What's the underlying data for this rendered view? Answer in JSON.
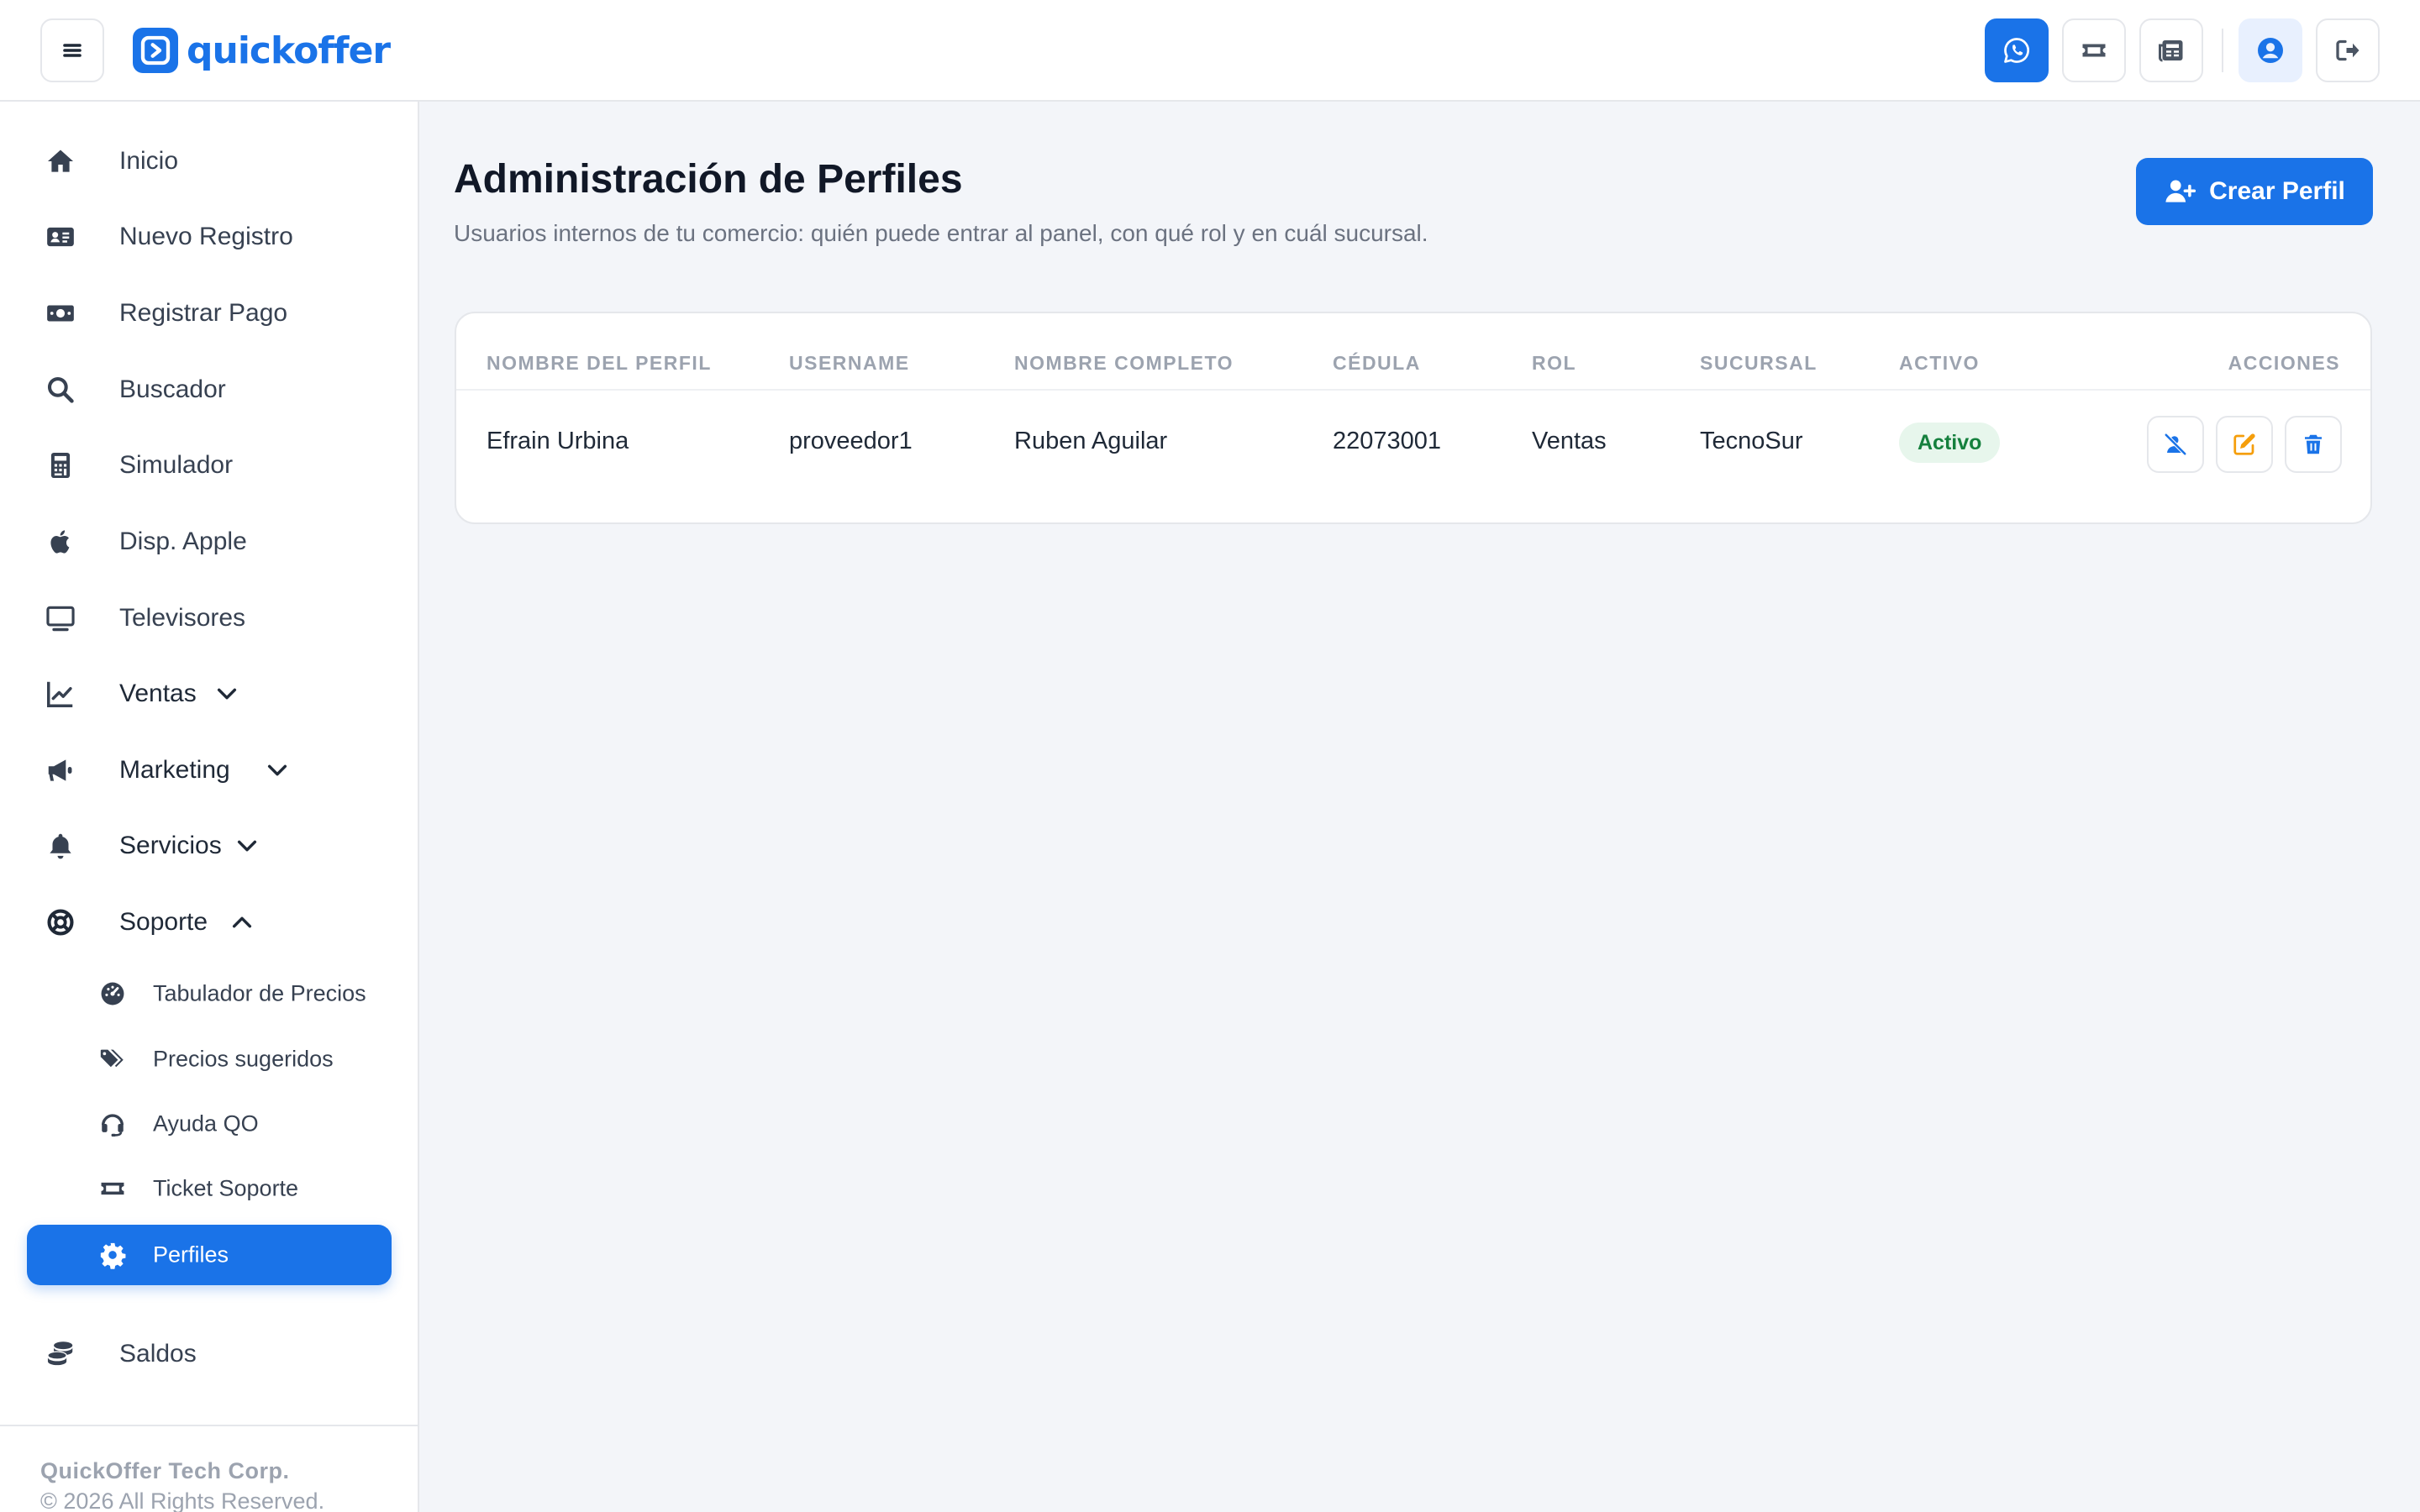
{
  "header": {
    "brand": "quickoffer",
    "buttons": [
      "menu-icon",
      "whatsapp-icon",
      "ticket-icon",
      "newspaper-icon",
      "user-circle-icon",
      "sign-out-icon"
    ]
  },
  "sidebar": {
    "items": [
      {
        "label": "Inicio",
        "icon": "home-icon"
      },
      {
        "label": "Nuevo Registro",
        "icon": "id-card-icon"
      },
      {
        "label": "Registrar Pago",
        "icon": "money-bill-icon"
      },
      {
        "label": "Buscador",
        "icon": "search-icon"
      },
      {
        "label": "Simulador",
        "icon": "calculator-icon"
      },
      {
        "label": "Disp. Apple",
        "icon": "apple-icon"
      },
      {
        "label": "Televisores",
        "icon": "tv-icon"
      },
      {
        "label": "Ventas",
        "icon": "chart-line-icon",
        "expanded": false
      },
      {
        "label": "Marketing",
        "icon": "bullhorn-icon",
        "expanded": false
      },
      {
        "label": "Servicios",
        "icon": "bell-icon",
        "expanded": false
      },
      {
        "label": "Soporte",
        "icon": "life-ring-icon",
        "expanded": true
      },
      {
        "label": "Saldos",
        "icon": "coins-icon"
      }
    ],
    "sub_items": [
      {
        "label": "Tabulador de Precios",
        "icon": "tachometer-icon"
      },
      {
        "label": "Precios sugeridos",
        "icon": "tags-icon"
      },
      {
        "label": "Ayuda QO",
        "icon": "headset-icon"
      },
      {
        "label": "Ticket Soporte",
        "icon": "ticket-icon"
      },
      {
        "label": "Perfiles",
        "icon": "cog-icon",
        "active": true
      }
    ],
    "footer": {
      "company": "QuickOffer Tech Corp.",
      "rights": "© 2026 All Rights Reserved."
    }
  },
  "main": {
    "title": "Administración de Perfiles",
    "subtitle": "Usuarios internos de tu comercio: quién puede entrar al panel, con qué rol y en cuál sucursal.",
    "create_button": "Crear Perfil",
    "table": {
      "headers": [
        "NOMBRE DEL PERFIL",
        "USERNAME",
        "NOMBRE COMPLETO",
        "CÉDULA",
        "ROL",
        "SUCURSAL",
        "ACTIVO",
        "ACCIONES"
      ],
      "rows": [
        {
          "profile_name": "Efrain Urbina",
          "username": "proveedor1",
          "full_name": "Ruben Aguilar",
          "cedula": "22073001",
          "rol": "Ventas",
          "sucursal": "TecnoSur",
          "activo": "Activo"
        }
      ]
    }
  },
  "colors": {
    "primary": "#1a73e8",
    "success_text": "#15803d",
    "success_bg": "#e7f6ec",
    "warning": "#f59e0b",
    "page_bg": "#f3f5f9"
  }
}
